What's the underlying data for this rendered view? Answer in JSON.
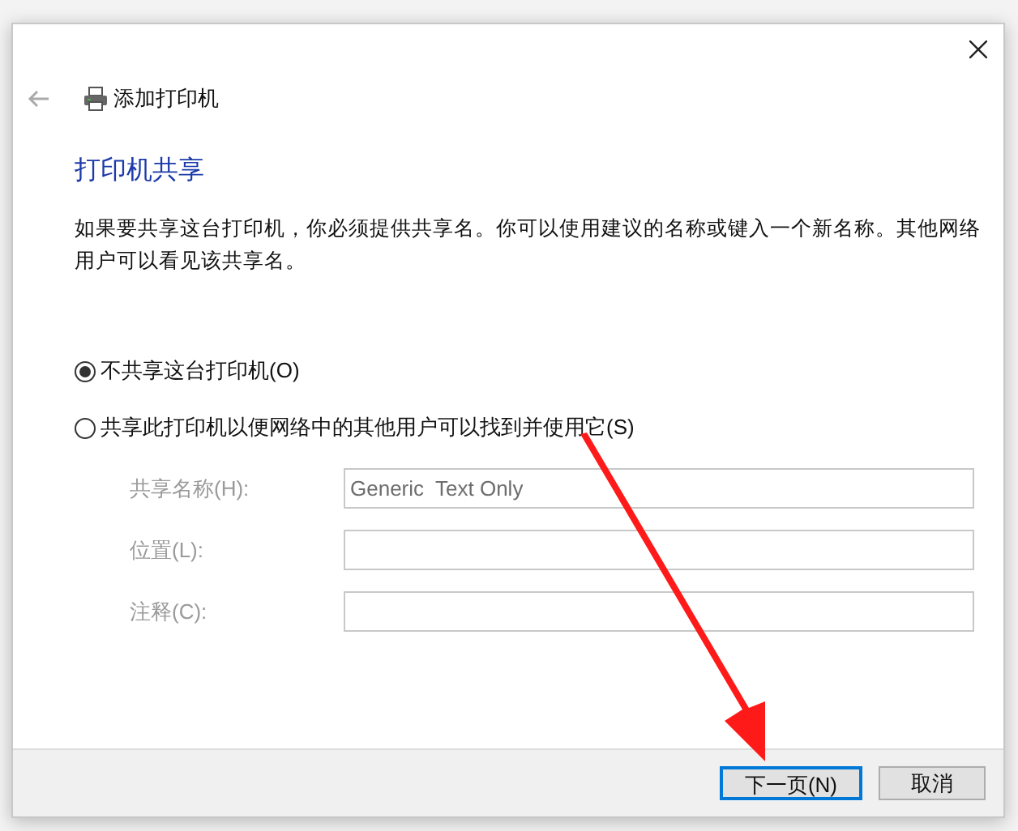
{
  "window": {
    "title": "添加打印机"
  },
  "heading": "打印机共享",
  "description": "如果要共享这台打印机，你必须提供共享名。你可以使用建议的名称或键入一个新名称。其他网络用户可以看见该共享名。",
  "options": [
    {
      "label": "不共享这台打印机(O)",
      "selected": true
    },
    {
      "label": "共享此打印机以便网络中的其他用户可以找到并使用它(S)",
      "selected": false
    }
  ],
  "fields": [
    {
      "label": "共享名称(H):",
      "value": "Generic  Text Only",
      "disabled": true
    },
    {
      "label": "位置(L):",
      "disabled": true
    },
    {
      "label": "注释(C):",
      "disabled": true
    }
  ],
  "buttons": [
    {
      "label": "下一页(N)",
      "default": true
    },
    {
      "label": "取消",
      "default": false
    }
  ]
}
